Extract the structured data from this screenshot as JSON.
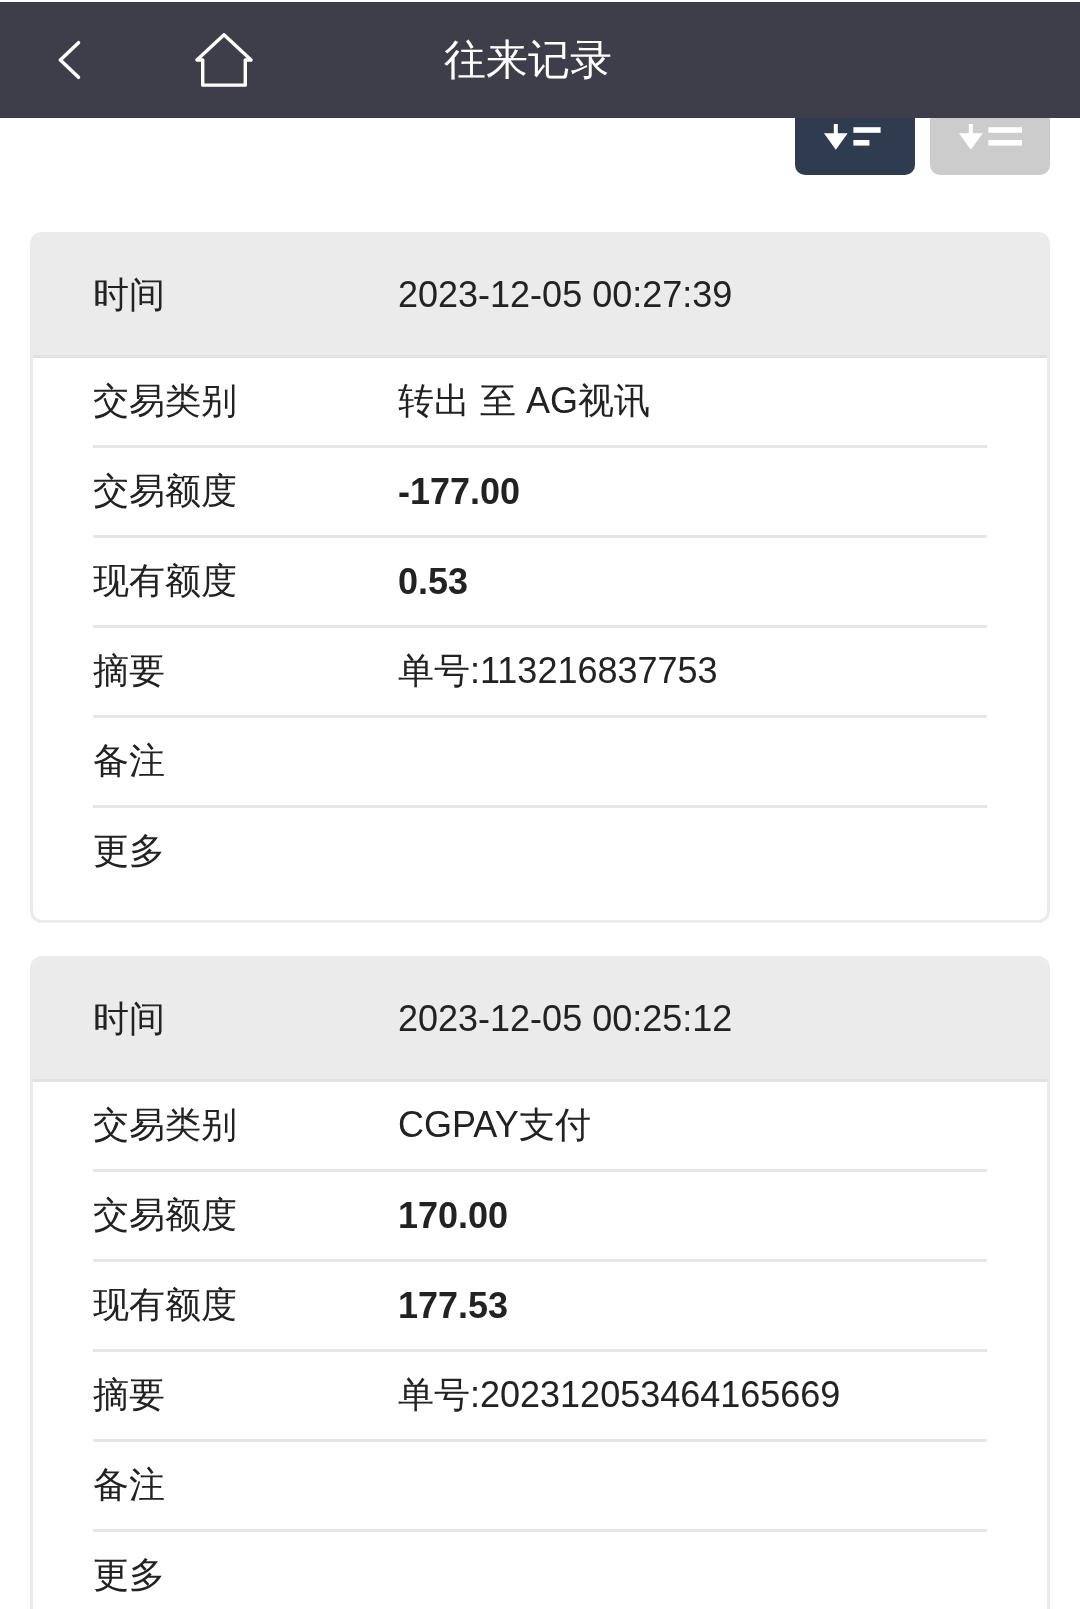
{
  "header": {
    "title": "往来记录"
  },
  "sort_buttons": [
    {
      "selected": true
    },
    {
      "selected": false
    }
  ],
  "records": [
    {
      "time_label": "时间",
      "time": "2023-12-05 00:27:39",
      "rows": [
        {
          "label": "交易类别",
          "value": "转出 至 AG视讯",
          "kind": "text"
        },
        {
          "label": "交易额度",
          "value": "-177.00",
          "kind": "amount"
        },
        {
          "label": "现有额度",
          "value": "0.53",
          "kind": "amount"
        },
        {
          "label": "摘要",
          "value": "单号:113216837753",
          "kind": "text"
        },
        {
          "label": "备注"
        },
        {
          "label": "更多"
        }
      ]
    },
    {
      "time_label": "时间",
      "time": "2023-12-05 00:25:12",
      "rows": [
        {
          "label": "交易类别",
          "value": "CGPAY支付",
          "kind": "text"
        },
        {
          "label": "交易额度",
          "value": "170.00",
          "kind": "amount"
        },
        {
          "label": "现有额度",
          "value": "177.53",
          "kind": "amount"
        },
        {
          "label": "摘要",
          "value": "单号:202312053464165669",
          "kind": "text"
        },
        {
          "label": "备注"
        },
        {
          "label": "更多"
        }
      ]
    }
  ]
}
